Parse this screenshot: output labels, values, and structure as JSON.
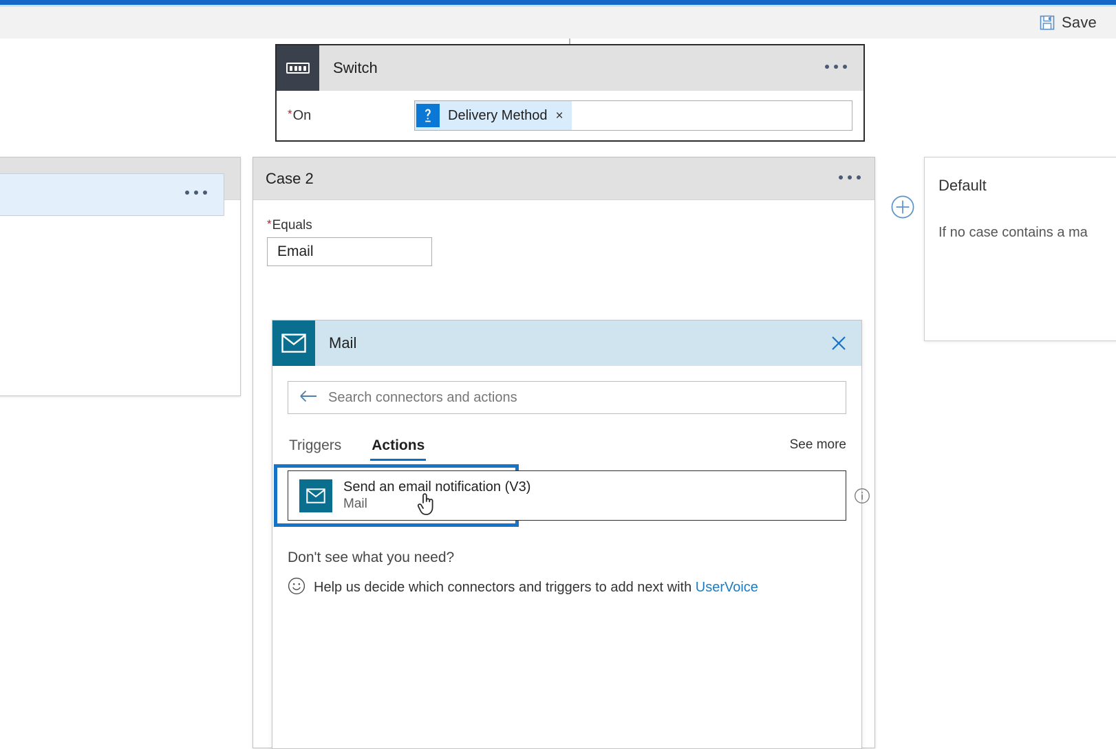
{
  "theme": {
    "accent_blue": "#1668c8",
    "selection_blue": "#1673c8",
    "mail_teal": "#0a6e8f",
    "token_blue": "#0a78d4",
    "switch_dark": "#3b414c",
    "link_blue": "#1b7cc2",
    "required_red": "#a4262c"
  },
  "commandbar": {
    "save_label": "Save",
    "save_icon": "save-floppy-icon"
  },
  "switch_card": {
    "title": "Switch",
    "icon": "switch-icon",
    "menu_icon": "ellipsis-icon",
    "on_field": {
      "label": "On",
      "required": true,
      "required_marker": "*",
      "token": {
        "label": "Delivery Method",
        "icon": "dynamic-content-icon",
        "remove_icon": "×"
      }
    }
  },
  "left_card": {
    "menu_icon": "ellipsis-icon",
    "subcard_menu_icon": "ellipsis-icon"
  },
  "case2_card": {
    "title": "Case 2",
    "menu_icon": "ellipsis-icon",
    "equals_field": {
      "label": "Equals",
      "required": true,
      "required_marker": "*",
      "value": "Email"
    }
  },
  "mail_panel": {
    "title": "Mail",
    "icon": "envelope-icon",
    "close_icon": "close-icon",
    "search": {
      "back_icon": "back-arrow-icon",
      "placeholder": "Search connectors and actions",
      "value": ""
    },
    "tabs": [
      {
        "label": "Triggers",
        "active": false
      },
      {
        "label": "Actions",
        "active": true
      }
    ],
    "see_more_label": "See more",
    "results": [
      {
        "name": "Send an email notification (V3)",
        "connector": "Mail",
        "icon": "envelope-icon",
        "info_icon": "info-circle-icon",
        "selected": true
      }
    ],
    "help": {
      "title": "Don't see what you need?",
      "icon": "smiley-face-icon",
      "text_before": "Help us decide which connectors and triggers to add next with ",
      "link_label": "UserVoice"
    }
  },
  "add_case_button": {
    "icon": "plus-circle-icon",
    "label": ""
  },
  "default_card": {
    "title": "Default",
    "description": "If no case contains a ma"
  },
  "cursor": {
    "icon": "pointing-hand-cursor"
  }
}
